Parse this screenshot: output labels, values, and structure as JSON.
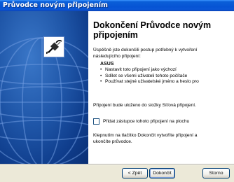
{
  "window": {
    "title": "Průvodce novým připojením"
  },
  "side_panel": {
    "icon": "network-cable-icon",
    "background": "globe-watermark"
  },
  "main": {
    "heading_line1": "Dokončení Průvodce novým",
    "heading_line2": "připojením",
    "intro_line1": "Úspěšně jste dokončili postup potřebný k vytvoření",
    "intro_line2": "následujícího připojení:",
    "connection_name": "ASUS",
    "bullets": [
      "Nastavit toto připojení jako výchozí",
      "Sdílet se všemi uživateli tohoto počítače",
      "Používat stejné uživatelské jméno a heslo pro"
    ],
    "bullet_glyph": "•",
    "save_note": "Připojení bude uloženo do složky Síťová připojení.",
    "shortcut_checkbox": {
      "label": "Přidat zástupce tohoto připojení na plochu",
      "checked": false
    },
    "finish_note_line1": "Klepnutím na tlačítko Dokončit vytvoříte připojení a",
    "finish_note_line2": "ukončíte průvodce."
  },
  "buttons": {
    "back": "< Zpět",
    "finish": "Dokončit",
    "cancel": "Storno"
  },
  "colors": {
    "titlebar": "#0a56d6",
    "side_panel": "#1f56a8",
    "dialog_face": "#ece9d8",
    "button_border": "#003c74"
  }
}
